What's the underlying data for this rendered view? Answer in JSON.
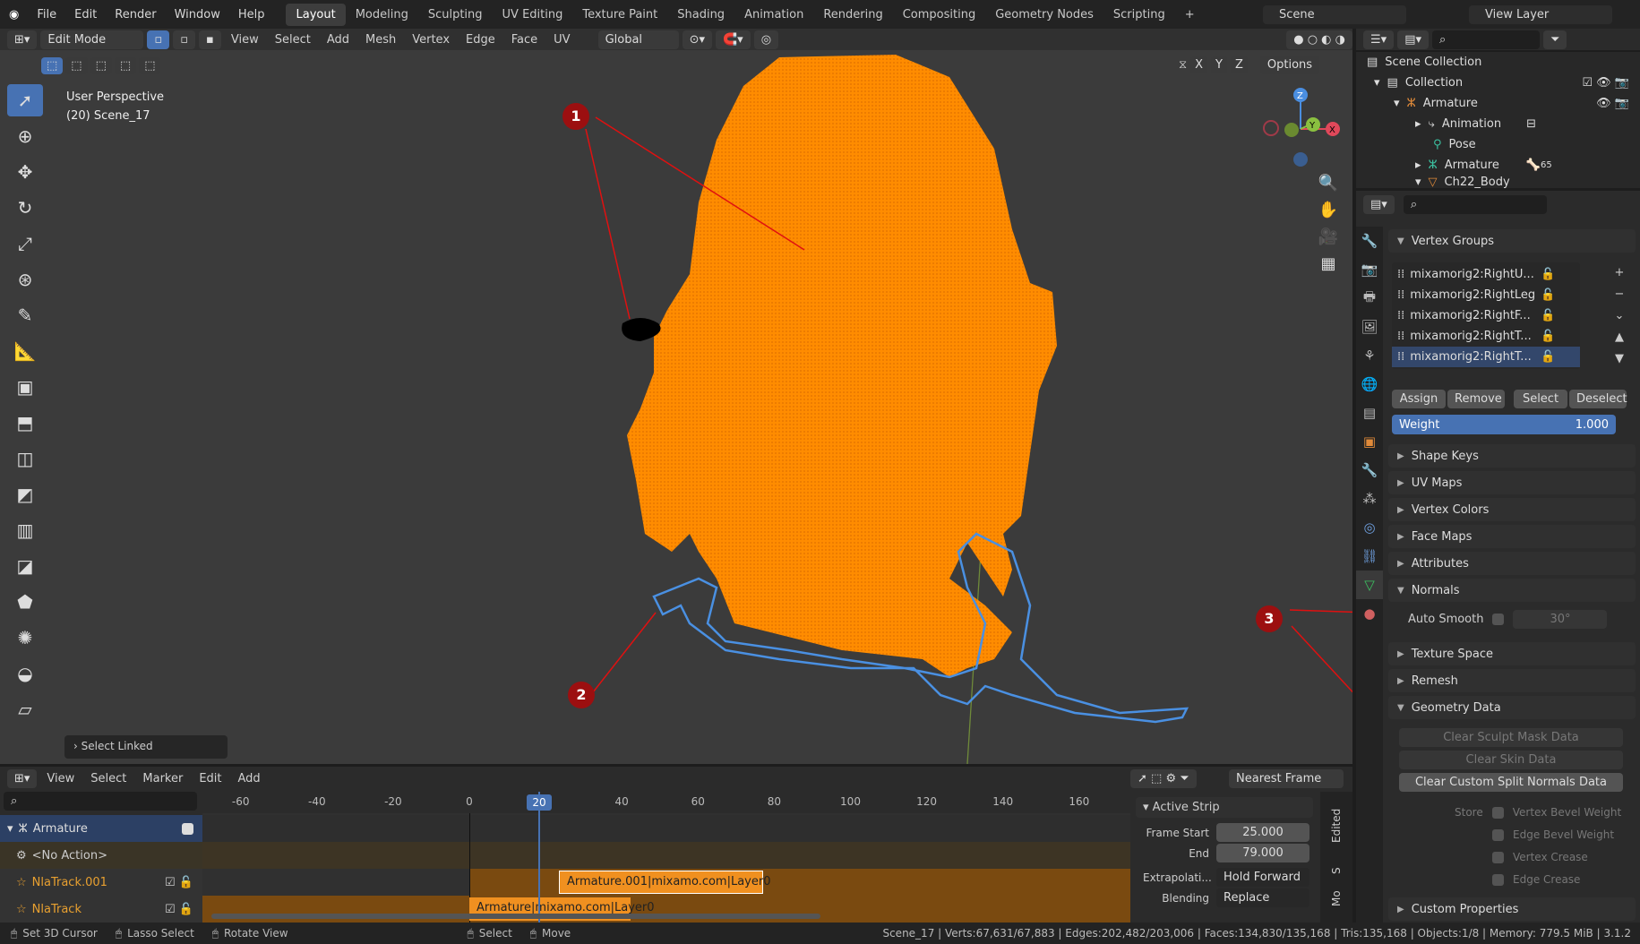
{
  "topbar": {
    "menus": [
      "File",
      "Edit",
      "Render",
      "Window",
      "Help"
    ],
    "workspaces": [
      "Layout",
      "Modeling",
      "Sculpting",
      "UV Editing",
      "Texture Paint",
      "Shading",
      "Animation",
      "Rendering",
      "Compositing",
      "Geometry Nodes",
      "Scripting"
    ],
    "active_workspace": "Layout",
    "scene": "Scene",
    "view_layer": "View Layer"
  },
  "viewport_header": {
    "mode": "Edit Mode",
    "menus": [
      "View",
      "Select",
      "Add",
      "Mesh",
      "Vertex",
      "Edge",
      "Face",
      "UV"
    ],
    "transform_orientation": "Global",
    "options": "Options",
    "axes": [
      "X",
      "Y",
      "Z"
    ]
  },
  "viewport": {
    "perspective": "User Perspective",
    "object": "(20) Scene_17",
    "last_op": "Select Linked",
    "gizmo": {
      "z": "Z",
      "y": "Y",
      "x": "X"
    }
  },
  "annotations": [
    "1",
    "2",
    "3"
  ],
  "outliner": {
    "items": [
      {
        "label": "Scene Collection"
      },
      {
        "label": "Collection"
      },
      {
        "label": "Armature"
      },
      {
        "label": "Animation"
      },
      {
        "label": "Pose"
      },
      {
        "label": "Armature",
        "badge": "65"
      },
      {
        "label": "Ch22_Body"
      }
    ]
  },
  "properties": {
    "vertex_groups": {
      "title": "Vertex Groups",
      "items": [
        "mixamorig2:RightU...",
        "mixamorig2:RightLeg",
        "mixamorig2:RightF...",
        "mixamorig2:RightT...",
        "mixamorig2:RightT..."
      ],
      "buttons": [
        "Assign",
        "Remove",
        "Select",
        "Deselect"
      ],
      "weight_label": "Weight",
      "weight_value": "1.000"
    },
    "panels": [
      "Shape Keys",
      "UV Maps",
      "Vertex Colors",
      "Face Maps",
      "Attributes"
    ],
    "normals": {
      "title": "Normals",
      "auto_smooth": "Auto Smooth",
      "angle": "30°"
    },
    "panels2": [
      "Texture Space",
      "Remesh"
    ],
    "geometry_data": {
      "title": "Geometry Data",
      "buttons": [
        "Clear Sculpt Mask Data",
        "Clear Skin Data",
        "Clear Custom Split Normals Data"
      ],
      "store_label": "Store",
      "store_options": [
        "Vertex Bevel Weight",
        "Edge Bevel Weight",
        "Vertex Crease",
        "Edge Crease"
      ]
    },
    "custom_properties": "Custom Properties"
  },
  "nla": {
    "menus": [
      "View",
      "Select",
      "Marker",
      "Edit",
      "Add"
    ],
    "snap": "Nearest Frame",
    "ticks": [
      "-60",
      "-40",
      "-20",
      "0",
      "20",
      "40",
      "60",
      "80",
      "100",
      "120",
      "140",
      "160"
    ],
    "current_frame": "20",
    "tracks": [
      "Armature",
      "<No Action>",
      "NlaTrack.001",
      "NlaTrack"
    ],
    "strips": [
      "Armature.001|mixamo.com|Layer0",
      "Armature|mixamo.com|Layer0"
    ],
    "sidebar": {
      "title": "Active Strip",
      "frame_start_label": "Frame Start",
      "frame_start": "25.000",
      "end_label": "End",
      "end": "79.000",
      "extrapolation_label": "Extrapolati...",
      "extrapolation": "Hold Forward",
      "blending_label": "Blending",
      "blending": "Replace",
      "tabs": [
        "Edited",
        "S",
        "Mo"
      ]
    }
  },
  "statusbar": {
    "hints": [
      "Set 3D Cursor",
      "Lasso Select",
      "Rotate View",
      "Select",
      "Move"
    ],
    "stats": "Scene_17 | Verts:67,631/67,883 | Edges:202,482/203,006 | Faces:134,830/135,168 | Tris:135,168 | Objects:1/8 | Memory: 779.5 MiB | 3.1.2"
  },
  "colors": {
    "accent": "#4772b3",
    "selection": "#ff8a00",
    "annotation": "#9c0f10",
    "outline": "#4a90e2"
  }
}
